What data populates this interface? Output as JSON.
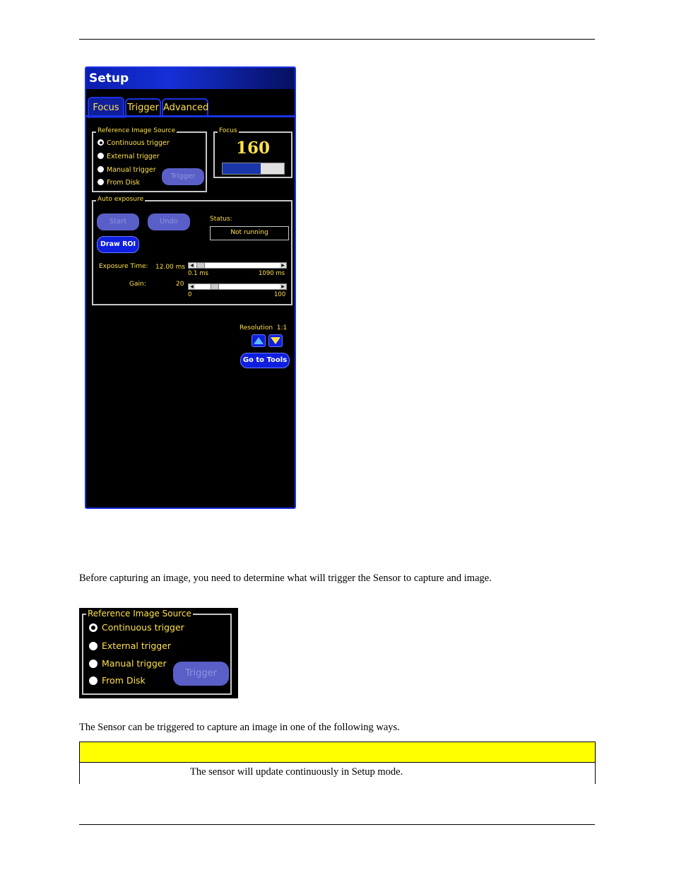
{
  "setup_panel": {
    "title": "Setup",
    "tabs": [
      "Focus",
      "Trigger",
      "Advanced"
    ],
    "reference_source": {
      "title": "Reference Image Source",
      "options": [
        "Continuous trigger",
        "External trigger",
        "Manual trigger",
        "From Disk"
      ],
      "selected": "Continuous trigger",
      "trigger_button": "Trigger"
    },
    "focus": {
      "title": "Focus",
      "value": "160",
      "level": 0.62
    },
    "auto_exposure": {
      "title": "Auto exposure",
      "start_button": "Start",
      "undo_button": "Undo",
      "status_label": "Status:",
      "status_value": "Not running",
      "draw_roi_button": "Draw ROI",
      "exposure_label": "Exposure Time:",
      "exposure_value": "12.00 ms",
      "exposure_min": "0.1 ms",
      "exposure_max": "1090 ms",
      "exposure_position": 0.02,
      "gain_label": "Gain:",
      "gain_value": "20",
      "gain_min": "0",
      "gain_max": "100",
      "gain_position": 0.2
    },
    "resolution_label": "Resolution  1:1",
    "go_to_tools_button": "Go to Tools"
  },
  "text": {
    "paragraph1": "Before capturing an image, you need to determine what will trigger the Sensor to capture and image.",
    "paragraph2": "The Sensor can be triggered to capture an image in one of the following ways."
  },
  "crop": {
    "title": "Reference Image Source",
    "options": [
      "Continuous trigger",
      "External trigger",
      "Manual trigger",
      "From Disk"
    ],
    "trigger_button": "Trigger"
  },
  "table": {
    "header": "",
    "row1_description": "The sensor will update continuously in Setup mode."
  },
  "colors": {
    "panel_blue": "#1b33e6",
    "label_yellow": "#ffe14a",
    "table_header": "#ffff00"
  }
}
